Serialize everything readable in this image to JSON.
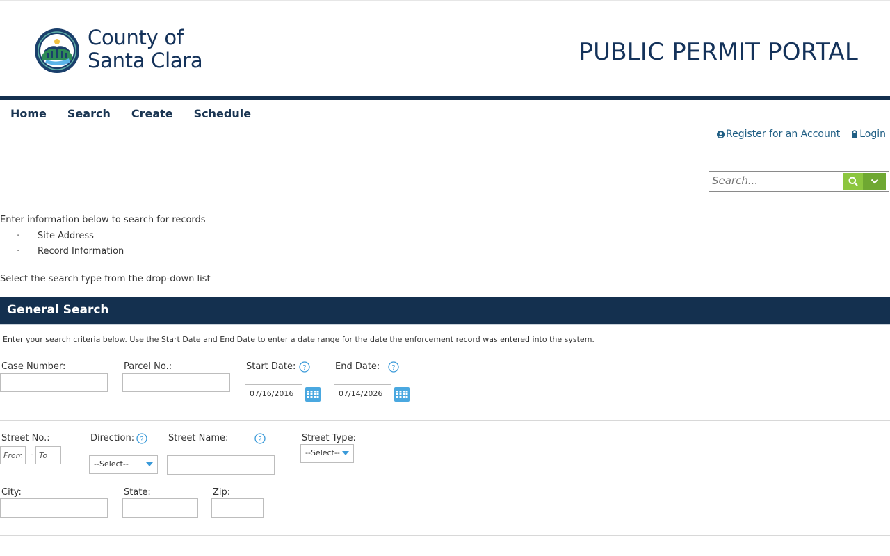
{
  "header": {
    "logo_line1": "County of",
    "logo_line2": "Santa Clara",
    "portal_title": "PUBLIC PERMIT PORTAL"
  },
  "nav": {
    "items": [
      "Home",
      "Search",
      "Create",
      "Schedule"
    ]
  },
  "account": {
    "register_label": "Register for an Account",
    "login_label": "Login"
  },
  "global_search": {
    "placeholder": "Search..."
  },
  "intro": {
    "line1": "Enter information below to search for records",
    "bullets": [
      "Site Address",
      "Record Information"
    ],
    "select_msg": "Select the search type from the drop-down list"
  },
  "section": {
    "title": "General Search",
    "instructions": "Enter your search criteria below.  Use the Start Date and End Date to enter a date range for the date the enforcement record was entered into the system."
  },
  "form": {
    "case_number_label": "Case Number:",
    "parcel_label": "Parcel No.:",
    "start_date_label": "Start Date:",
    "end_date_label": "End Date:",
    "start_date_value": "07/16/2016",
    "end_date_value": "07/14/2026",
    "street_no_label": "Street No.:",
    "street_from_placeholder": "From",
    "street_to_placeholder": "To",
    "street_dash": "-",
    "direction_label": "Direction:",
    "direction_value": "--Select--",
    "street_name_label": "Street Name:",
    "street_type_label": "Street Type:",
    "street_type_value": "--Select--",
    "city_label": "City:",
    "state_label": "State:",
    "zip_label": "Zip:"
  },
  "colors": {
    "navy": "#14304f",
    "link": "#1f5e84",
    "search_green": "#8cc63f",
    "help_blue": "#3a9ad9"
  }
}
